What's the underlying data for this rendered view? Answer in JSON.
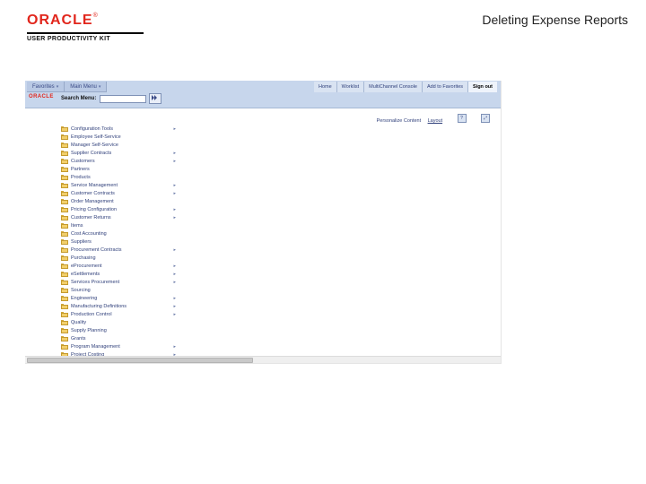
{
  "header": {
    "logo_main": "ORACLE",
    "logo_tm": "®",
    "logo_sub": "USER PRODUCTIVITY KIT",
    "page_title": "Deleting Expense Reports"
  },
  "app": {
    "nav_tabs": [
      {
        "label": "Favorites"
      },
      {
        "label": "Main Menu"
      }
    ],
    "global_links": [
      {
        "label": "Home",
        "key": "home"
      },
      {
        "label": "Worklist",
        "key": "worklist"
      },
      {
        "label": "MultiChannel Console",
        "key": "mcc"
      },
      {
        "label": "Add to Favorites",
        "key": "fav"
      },
      {
        "label": "Sign out",
        "key": "signout",
        "bold": true
      }
    ],
    "brand": "ORACLE",
    "search": {
      "label": "Search Menu:",
      "value": "",
      "placeholder": ""
    },
    "personalize": {
      "label": "Personalize Content",
      "user": "Layout",
      "help": "?",
      "http": "⤢"
    },
    "menu_items": [
      {
        "label": "Configuration Tools",
        "expandable": true
      },
      {
        "label": "Employee Self-Service",
        "expandable": false
      },
      {
        "label": "Manager Self-Service",
        "expandable": false
      },
      {
        "label": "Supplier Contracts",
        "expandable": true
      },
      {
        "label": "Customers",
        "expandable": true
      },
      {
        "label": "Partners",
        "expandable": false
      },
      {
        "label": "Products",
        "expandable": false
      },
      {
        "label": "Service Management",
        "expandable": true
      },
      {
        "label": "Customer Contracts",
        "expandable": true
      },
      {
        "label": "Order Management",
        "expandable": false
      },
      {
        "label": "Pricing Configuration",
        "expandable": true
      },
      {
        "label": "Customer Returns",
        "expandable": true
      },
      {
        "label": "Items",
        "expandable": false
      },
      {
        "label": "Cost Accounting",
        "expandable": false
      },
      {
        "label": "Suppliers",
        "expandable": false
      },
      {
        "label": "Procurement Contracts",
        "expandable": true
      },
      {
        "label": "Purchasing",
        "expandable": false
      },
      {
        "label": "eProcurement",
        "expandable": true
      },
      {
        "label": "eSettlements",
        "expandable": true
      },
      {
        "label": "Services Procurement",
        "expandable": true
      },
      {
        "label": "Sourcing",
        "expandable": false
      },
      {
        "label": "Engineering",
        "expandable": true
      },
      {
        "label": "Manufacturing Definitions",
        "expandable": true
      },
      {
        "label": "Production Control",
        "expandable": true
      },
      {
        "label": "Quality",
        "expandable": false
      },
      {
        "label": "Supply Planning",
        "expandable": false
      },
      {
        "label": "Grants",
        "expandable": false
      },
      {
        "label": "Program Management",
        "expandable": true
      },
      {
        "label": "Project Costing",
        "expandable": true
      }
    ]
  }
}
